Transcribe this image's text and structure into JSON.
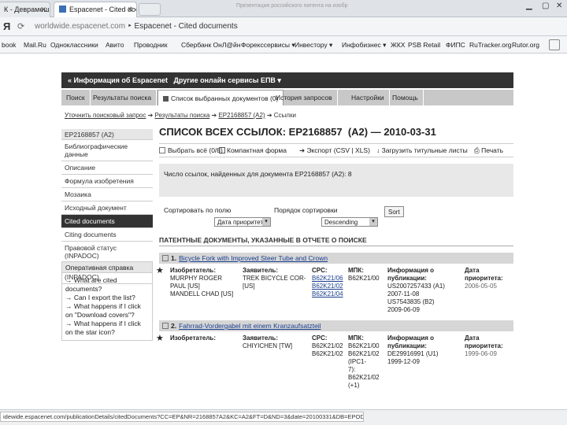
{
  "browser": {
    "tabs": [
      {
        "label": "К - Деврамешьк"
      },
      {
        "label": "Espacenet - Cited doc"
      }
    ],
    "faded_tab": "Презентация российского патента на изобр",
    "ya": "Я",
    "url_domain": "worldwide.espacenet.com",
    "url_title": "Espacenet - Cited documents",
    "bookmarks": [
      "book",
      "Mail.Ru",
      "Одноклассники",
      "Авито",
      "Проводник",
      "Сбербанк ОнЛ@йн",
      "Форекссервисы ▾",
      "Инвестору ▾",
      "Инфобизнес ▾",
      "ЖКХ",
      "PSB Retail",
      "ФИПС",
      "RuTracker.org",
      "Rutor.org"
    ]
  },
  "page": {
    "blackbar": "« Информация об Espacenet   Другие онлайн сервисы ЕПВ ▾",
    "tabs": [
      "Поиск",
      "Результаты поиска",
      "Список выбранных документов (0)",
      "История запросов",
      "Настройки",
      "Помощь"
    ],
    "breadcrumb": {
      "a": "Уточнить поисковый запрос",
      "b": "Результаты поиска",
      "c": "EP2168857 (A2)",
      "d": "Ссылки"
    },
    "sidebar": {
      "head": "EP2168857 (A2)",
      "items": [
        "Библиографические данные",
        "Описание",
        "Формула изобретения",
        "Мозаика",
        "Исходный документ",
        "Cited documents",
        "Citing documents",
        "Правовой статус (INPADOC)",
        "Документы-аналоги (INPADOC)"
      ],
      "help_head": "Оперативная справка",
      "help_items": [
        "→ What are cited documents?",
        "→ Can I export the list?",
        "→ What happens if I click on \"Download covers\"?",
        "→ What happens if I click on the star icon?"
      ]
    },
    "main": {
      "title": "СПИСОК ВСЕХ ССЫЛОК: EP2168857  (A2) — 2010-03-31",
      "toolbar": {
        "select_all": "Выбрать всё (0/8)",
        "compact": "Компактная форма",
        "export": "Экспорт (CSV | XLS)",
        "download": "Загрузить титульные листы",
        "print": "Печать"
      },
      "info": "Число ссылок, найденных для документа EP2168857 (A2): 8",
      "sort_by_label": "Сортировать по полю",
      "sort_by_value": "Дата приоритета",
      "order_label": "Порядок сортировки",
      "order_value": "Descending",
      "sort_button": "Sort",
      "section": "ПАТЕНТНЫЕ ДОКУМЕНТЫ, УКАЗАННЫЕ В ОТЧЕТЕ О ПОИСКЕ",
      "results": [
        {
          "num": "1.",
          "title": "Bicycle Fork with Improved Steer Tube and Crown",
          "inventor_h": "Изобретатель:",
          "inventor": [
            "MURPHY ROGER",
            "PAUL [US]",
            "MANDELL CHAD [US]"
          ],
          "applicant_h": "Заявитель:",
          "applicant": [
            "TREK BICYCLE COR-",
            "[US]"
          ],
          "cpc_h": "CPC:",
          "cpc": [
            "B62K21/06",
            "B62K21/02",
            "B62K21/04"
          ],
          "ipc_h": "МПК:",
          "ipc": [
            "B62K21/00"
          ],
          "pub_h": "Информация о публикации:",
          "pub": [
            "US2007257433 (A1)",
            "2007-11-08",
            "US7543835 (B2)",
            "2009-06-09"
          ],
          "prio_h": "Дата приоритета:",
          "prio": "2006-05-05"
        },
        {
          "num": "2.",
          "title": "Fahrrad-Vordergabel mit einem Kranzaufsatzteil",
          "inventor_h": "Изобретатель:",
          "inventor": [],
          "applicant_h": "Заявитель:",
          "applicant": [
            "CHIYICHEN [TW]"
          ],
          "cpc_h": "CPC:",
          "cpc": [
            "B62K21/02",
            "B62K21/02"
          ],
          "ipc_h": "МПК:",
          "ipc": [
            "B62K21/00",
            "B62K21/02",
            "(IPC1-",
            "7): B62K21/02",
            "(+1)"
          ],
          "pub_h": "Информация о публикации:",
          "pub": [
            "DE29916991 (U1)",
            "1999-12-09"
          ],
          "prio_h": "Дата приоритета:",
          "prio": "1999-06-09"
        }
      ]
    }
  },
  "statusbar": {
    "url": "idewide.espacenet.com/publicationDetails/citedDocuments?CC=EP&NR=2168857A2&KC=A2&FT=D&ND=3&date=20100331&DB=EPODOC&locale=ru_#"
  }
}
